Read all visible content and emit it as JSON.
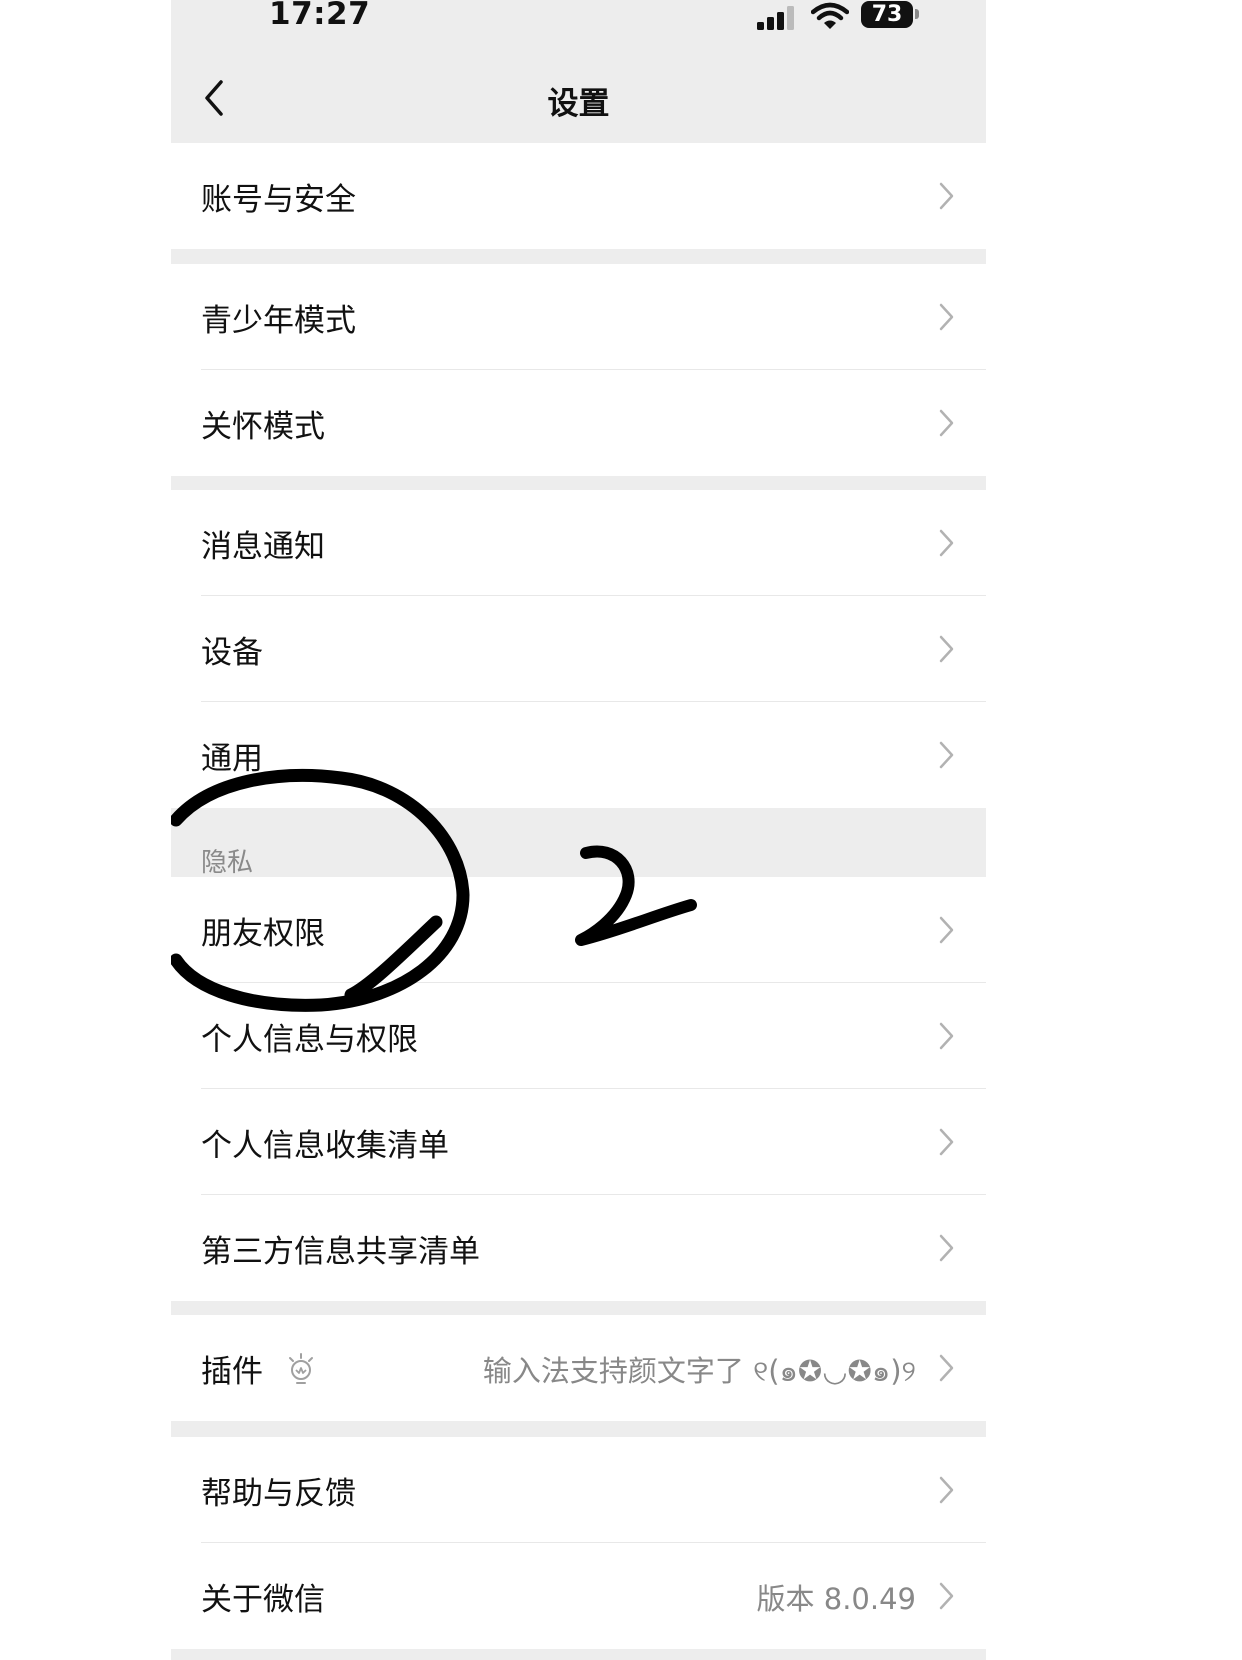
{
  "status_bar": {
    "time": "17:27",
    "battery": "73"
  },
  "nav": {
    "title": "设置"
  },
  "groups": [
    {
      "rows": [
        {
          "label": "账号与安全"
        }
      ]
    },
    {
      "rows": [
        {
          "label": "青少年模式"
        },
        {
          "label": "关怀模式"
        }
      ]
    },
    {
      "rows": [
        {
          "label": "消息通知"
        },
        {
          "label": "设备"
        },
        {
          "label": "通用"
        }
      ]
    },
    {
      "section_label": "隐私",
      "rows": [
        {
          "label": "朋友权限"
        },
        {
          "label": "个人信息与权限"
        },
        {
          "label": "个人信息收集清单"
        },
        {
          "label": "第三方信息共享清单"
        }
      ]
    },
    {
      "rows": [
        {
          "label": "插件",
          "value": "输入法支持颜文字了 ୧(๑✪◡✪๑)୨",
          "icon": "lightbulb-icon"
        }
      ]
    },
    {
      "rows": [
        {
          "label": "帮助与反馈"
        },
        {
          "label": "关于微信",
          "value": "版本 8.0.49"
        }
      ]
    }
  ],
  "annotation": {
    "mark": "2",
    "color": "#000000"
  }
}
